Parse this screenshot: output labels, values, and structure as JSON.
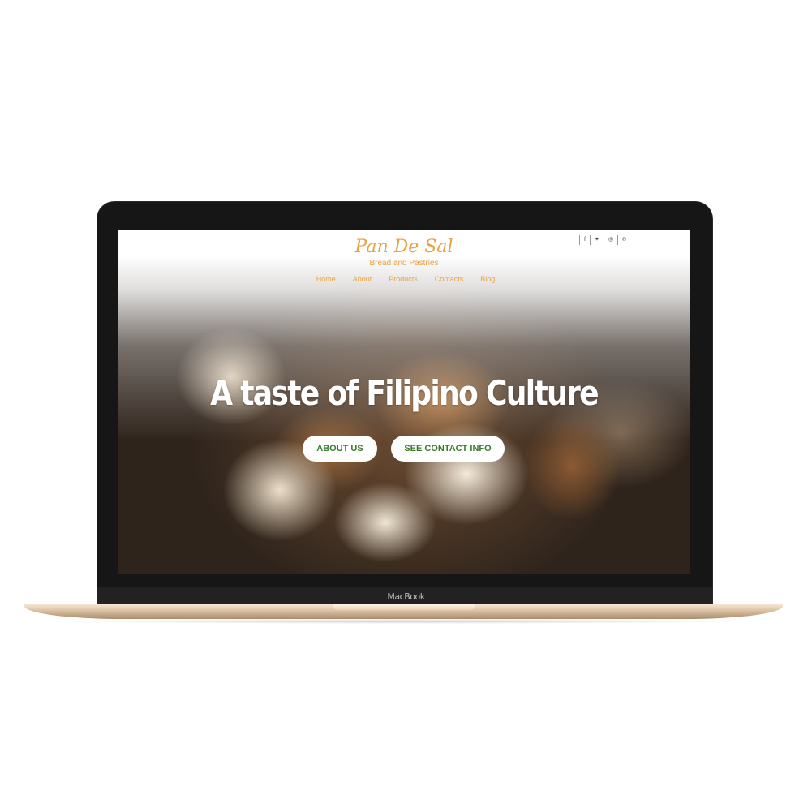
{
  "device": {
    "brand_label": "MacBook"
  },
  "site": {
    "logo_title": "Pan De Sal",
    "logo_tagline": "Bread and Pastries",
    "nav": [
      "Home",
      "About",
      "Products",
      "Contacts",
      "Blog"
    ],
    "social": [
      {
        "icon": "facebook-icon",
        "glyph": "f"
      },
      {
        "icon": "twitter-icon",
        "glyph": "✦"
      },
      {
        "icon": "instagram-icon",
        "glyph": "◎"
      },
      {
        "icon": "pinterest-icon",
        "glyph": "℗"
      }
    ],
    "hero_title": "A taste of Filipino Culture",
    "buttons": {
      "about": "ABOUT US",
      "contact": "SEE CONTACT INFO"
    },
    "colors": {
      "accent": "#e8a241",
      "button_text": "#3b7a2a"
    }
  }
}
